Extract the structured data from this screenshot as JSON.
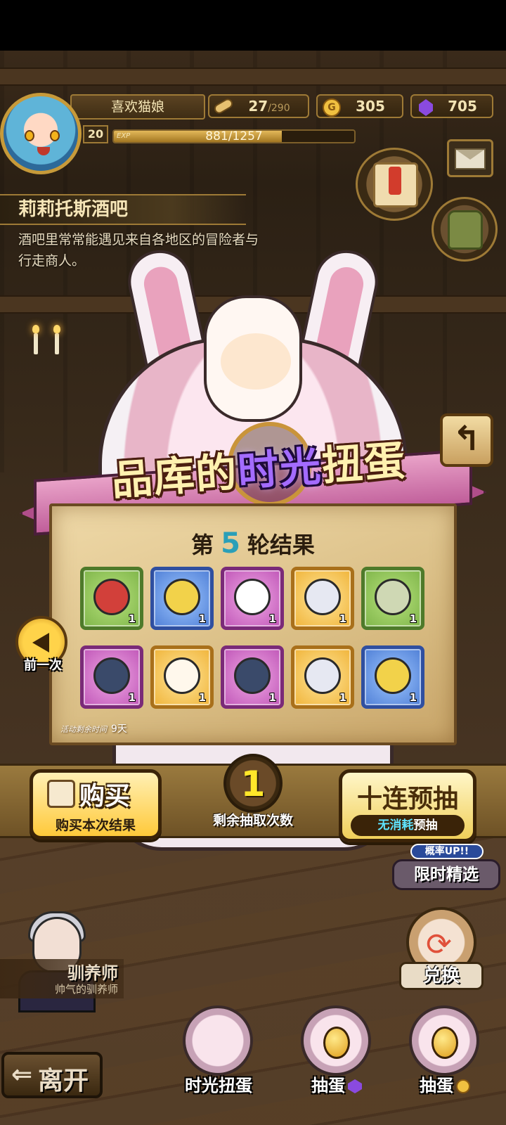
{
  "player": {
    "name": "喜欢猫娘",
    "level": "20",
    "exp_label": "EXP",
    "exp_text": "881/1257",
    "exp_fraction": 0.7
  },
  "resources": {
    "stamina": {
      "icon": "bread-stamina-icon",
      "value": "27",
      "max": "/290"
    },
    "gold": {
      "icon": "gold-coin-icon",
      "value": "305"
    },
    "gems": {
      "icon": "purple-gem-icon",
      "value": "705"
    }
  },
  "location": {
    "title": "莉莉托斯酒吧",
    "description": "酒吧里常常能遇见来自各地区的冒险者与行走商人。"
  },
  "banner": {
    "title_part1": "品库的",
    "title_highlight": "时光",
    "title_part2": "扭蛋"
  },
  "results": {
    "title_prefix": "第",
    "round": "5",
    "title_suffix": "轮结果",
    "items": [
      {
        "icon": "red-egg-icon",
        "rarity": "green",
        "qty": "1"
      },
      {
        "icon": "golden-orb-icon",
        "rarity": "blue",
        "qty": "1"
      },
      {
        "icon": "panda-bunny-icon",
        "rarity": "purple",
        "qty": "1"
      },
      {
        "icon": "crown-shell-icon",
        "rarity": "gold",
        "qty": "1"
      },
      {
        "icon": "planet-shell-icon",
        "rarity": "green",
        "qty": "1"
      },
      {
        "icon": "claw-lifebuoy-icon",
        "rarity": "purple",
        "qty": "1"
      },
      {
        "icon": "angel-egg-icon",
        "rarity": "gold",
        "qty": "1"
      },
      {
        "icon": "claw-lifebuoy-icon",
        "rarity": "purple",
        "qty": "1"
      },
      {
        "icon": "crown-shell-icon",
        "rarity": "gold",
        "qty": "1"
      },
      {
        "icon": "golden-orb-icon",
        "rarity": "blue",
        "qty": "1"
      }
    ],
    "event_time_label": "活动剩余时间",
    "event_time_value": "9天"
  },
  "prev_button": {
    "label": "前一次"
  },
  "buy_button": {
    "title": "购买",
    "subtitle": "购买本次结果"
  },
  "draws": {
    "remaining": "1",
    "label": "剩余抽取次数"
  },
  "ten_button": {
    "title": "十连预抽",
    "sub_highlight": "无消耗",
    "sub_rest": "预抽"
  },
  "limited": {
    "badge": "概率UP!!",
    "label": "限时精选"
  },
  "exchange": {
    "label": "兑换"
  },
  "npc": {
    "role": "驯养师",
    "description": "帅气的驯养师"
  },
  "leave": {
    "label": "离开"
  },
  "bottom_tabs": [
    {
      "label": "时光扭蛋"
    },
    {
      "label": "抽蛋",
      "currency": "purple-gem-icon"
    },
    {
      "label": "抽蛋",
      "currency": "gold-coin-icon"
    }
  ],
  "colors": {
    "round_number": "#2a9fb8",
    "draw_count": "#ffe72a",
    "banner_highlight": "#a36bff"
  }
}
